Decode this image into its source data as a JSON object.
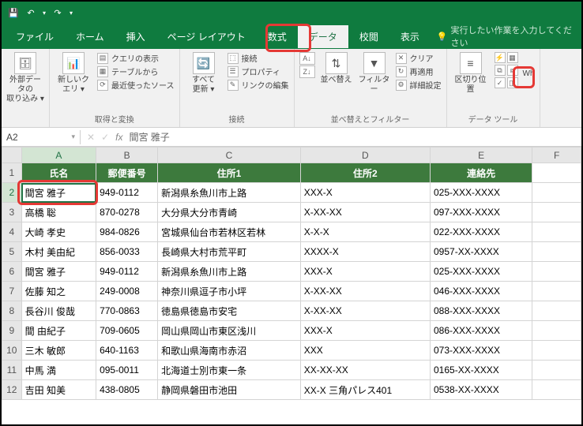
{
  "titlebar": {
    "save_icon": "💾",
    "undo_icon": "↶",
    "redo_icon": "↷"
  },
  "tabs": {
    "file": "ファイル",
    "home": "ホーム",
    "insert": "挿入",
    "layout": "ページ レイアウト",
    "formulas": "数式",
    "data": "データ",
    "review": "校閲",
    "view": "表示",
    "tell": "実行したい作業を入力してください"
  },
  "ribbon": {
    "g1": {
      "ext": "外部データの\n取り込み ▾"
    },
    "g2": {
      "newq": "新しいク\nエリ ▾",
      "showq": "クエリの表示",
      "fromtable": "テーブルから",
      "recent": "最近使ったソース",
      "label": "取得と変換"
    },
    "g3": {
      "refresh": "すべて\n更新 ▾",
      "conn": "接続",
      "prop": "プロパティ",
      "editlink": "リンクの編集",
      "label": "接続"
    },
    "g4": {
      "sort": "並べ替え",
      "filter": "フィルター",
      "clear": "クリア",
      "reapply": "再適用",
      "adv": "詳細設定",
      "label": "並べ替えとフィルター"
    },
    "g5": {
      "textcol": "区切り位置",
      "label": "データ ツール",
      "wh": "Wh"
    }
  },
  "namebox": {
    "ref": "A2",
    "formula": "間宮 雅子"
  },
  "cols": [
    "A",
    "B",
    "C",
    "D",
    "E",
    "F"
  ],
  "headers": {
    "c1": "氏名",
    "c2": "郵便番号",
    "c3": "住所1",
    "c4": "住所2",
    "c5": "連絡先"
  },
  "rows": [
    {
      "n": "2",
      "a": "間宮 雅子",
      "b": "949-0112",
      "c": "新潟県糸魚川市上路",
      "d": "XXX-X",
      "e": "025-XXX-XXXX"
    },
    {
      "n": "3",
      "a": "高橋 聡",
      "b": "870-0278",
      "c": "大分県大分市青崎",
      "d": "X-XX-XX",
      "e": "097-XXX-XXXX"
    },
    {
      "n": "4",
      "a": "大崎 孝史",
      "b": "984-0826",
      "c": "宮城県仙台市若林区若林",
      "d": "X-X-X",
      "e": "022-XXX-XXXX"
    },
    {
      "n": "5",
      "a": "木村 美由紀",
      "b": "856-0033",
      "c": "長崎県大村市荒平町",
      "d": "XXXX-X",
      "e": "0957-XX-XXXX"
    },
    {
      "n": "6",
      "a": "間宮 雅子",
      "b": "949-0112",
      "c": "新潟県糸魚川市上路",
      "d": "XXX-X",
      "e": "025-XXX-XXXX"
    },
    {
      "n": "7",
      "a": "佐藤 知之",
      "b": "249-0008",
      "c": "神奈川県逗子市小坪",
      "d": "X-XX-XX",
      "e": "046-XXX-XXXX"
    },
    {
      "n": "8",
      "a": "長谷川 俊哉",
      "b": "770-0863",
      "c": "徳島県徳島市安宅",
      "d": "X-XX-XX",
      "e": "088-XXX-XXXX"
    },
    {
      "n": "9",
      "a": "間 由紀子",
      "b": "709-0605",
      "c": "岡山県岡山市東区浅川",
      "d": "XXX-X",
      "e": "086-XXX-XXXX"
    },
    {
      "n": "10",
      "a": "三木 敏郎",
      "b": "640-1163",
      "c": "和歌山県海南市赤沼",
      "d": "XXX",
      "e": "073-XXX-XXXX"
    },
    {
      "n": "11",
      "a": "中馬 満",
      "b": "095-0011",
      "c": "北海道士別市東一条",
      "d": "XX-XX-XX",
      "e": "0165-XX-XXXX"
    },
    {
      "n": "12",
      "a": "吉田 知美",
      "b": "438-0805",
      "c": "静岡県磐田市池田",
      "d": "XX-X 三角パレス401",
      "e": "0538-XX-XXXX"
    }
  ]
}
